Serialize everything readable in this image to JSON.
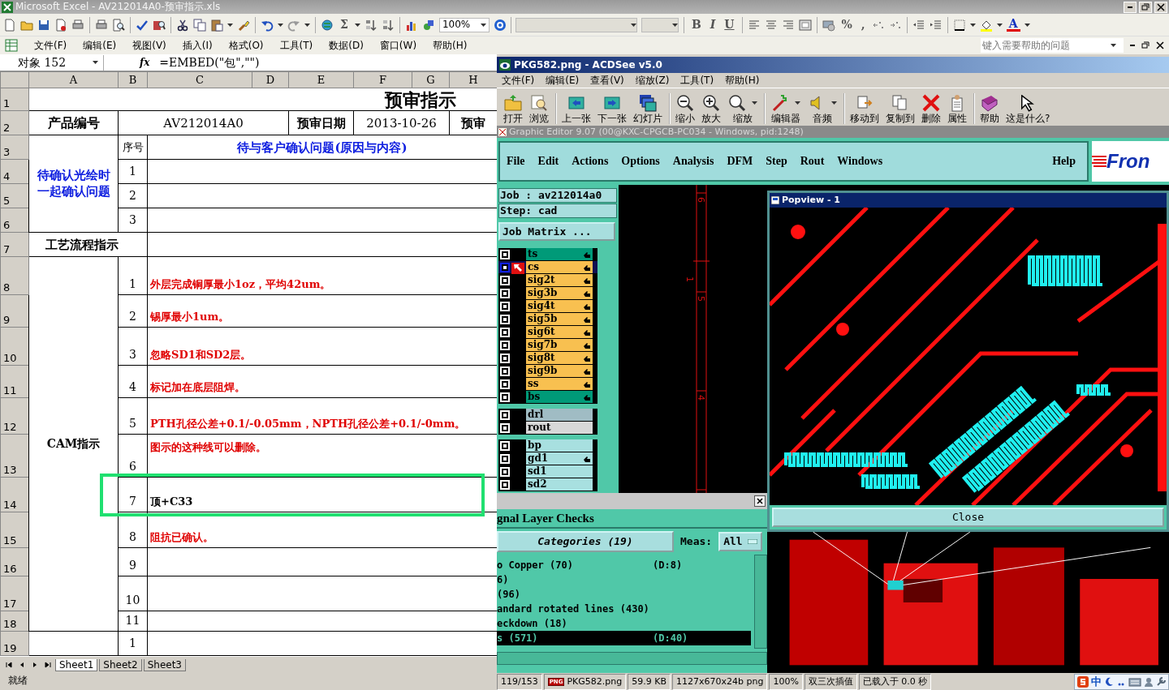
{
  "excel": {
    "title": "Microsoft Excel - AV212014A0-预审指示.xls",
    "sum_glyph": "Σ",
    "zoom": "100%",
    "format_glyphs": [
      "B",
      "I",
      "U"
    ],
    "number_glyphs": [
      "%",
      ","
    ],
    "font_color_glyph": "A",
    "menu": [
      "文件(F)",
      "编辑(E)",
      "视图(V)",
      "插入(I)",
      "格式(O)",
      "工具(T)",
      "数据(D)",
      "窗口(W)",
      "帮助(H)"
    ],
    "help_placeholder": "键入需要帮助的问题",
    "name_box": "对象 152",
    "function_glyph": "fx",
    "formula": "=EMBED(\"包\",\"\")",
    "columns": [
      "A",
      "B",
      "C",
      "D",
      "E",
      "F",
      "G",
      "H"
    ],
    "row_numbers": [
      "1",
      "2",
      "3",
      "4",
      "5",
      "6",
      "7",
      "8",
      "9",
      "10",
      "11",
      "12",
      "13",
      "14",
      "15",
      "16",
      "17",
      "18",
      "19"
    ],
    "sheet": {
      "title": "预审指示",
      "product_label": "产品编号",
      "product_no": "AV212014A0",
      "date_label": "预审日期",
      "date": "2013-10-26",
      "review_label": "预审",
      "confirm_label": "待确认光绘时一起确认问题",
      "seq_label": "序号",
      "question_label": "待与客户确认问题(原因与内容)",
      "confirm_numbers": [
        "1",
        "2",
        "3"
      ],
      "process_label": "工艺流程指示",
      "cam_label": "CAM指示",
      "cam_items": [
        {
          "no": "1",
          "text": "外层完成铜厚最小1oz，平均42um。",
          "color": "#e00000"
        },
        {
          "no": "2",
          "text": "锡厚最小1um。",
          "color": "#e00000"
        },
        {
          "no": "3",
          "text": "忽略SD1和SD2层。",
          "color": "#e00000"
        },
        {
          "no": "4",
          "text": "标记加在底层阻焊。",
          "color": "#e00000"
        },
        {
          "no": "5",
          "text": "PTH孔径公差+0.1/-0.05mm，NPTH孔径公差+0.1/-0mm。",
          "color": "#e00000"
        },
        {
          "no": "6",
          "text": "图示的这种线可以删除。",
          "color": "#e00000"
        },
        {
          "no": "7",
          "text": "顶+C33",
          "color": "#000000"
        },
        {
          "no": "8",
          "text": "阻抗已确认。",
          "color": "#e00000"
        },
        {
          "no": "9"
        },
        {
          "no": "10"
        },
        {
          "no": "11"
        }
      ],
      "last_row_no": "1"
    },
    "sheet_tabs": [
      {
        "label": "Sheet1",
        "selected": true
      },
      {
        "label": "Sheet2",
        "selected": false
      },
      {
        "label": "Sheet3",
        "selected": false
      }
    ],
    "status": "就绪"
  },
  "acdsee": {
    "title": "PKG582.png - ACDSee v5.0",
    "menu": [
      "文件(F)",
      "编辑(E)",
      "查看(V)",
      "缩放(Z)",
      "工具(T)",
      "帮助(H)"
    ],
    "toolbar": [
      {
        "label": "打开",
        "dropdown": false,
        "separator_after": false
      },
      {
        "label": "浏览",
        "dropdown": false,
        "separator_after": true
      },
      {
        "label": "上一张",
        "dropdown": false,
        "separator_after": false
      },
      {
        "label": "下一张",
        "dropdown": false,
        "separator_after": false
      },
      {
        "label": "幻灯片",
        "dropdown": false,
        "separator_after": true
      },
      {
        "label": "缩小",
        "dropdown": false,
        "separator_after": false
      },
      {
        "label": "放大",
        "dropdown": false,
        "separator_after": false
      },
      {
        "label": "缩放",
        "dropdown": true,
        "separator_after": true
      },
      {
        "label": "编辑器",
        "dropdown": true,
        "separator_after": false
      },
      {
        "label": "音频",
        "dropdown": true,
        "separator_after": true
      },
      {
        "label": "移动到",
        "dropdown": false,
        "separator_after": false
      },
      {
        "label": "复制到",
        "dropdown": false,
        "separator_after": false
      },
      {
        "label": "删除",
        "dropdown": false,
        "separator_after": false
      },
      {
        "label": "属性",
        "dropdown": false,
        "separator_after": true
      },
      {
        "label": "帮助",
        "dropdown": false,
        "separator_after": false
      },
      {
        "label": "这是什么?",
        "dropdown": false,
        "separator_after": false
      }
    ],
    "image": {
      "title": "Graphic Editor 9.07 (00@KXC-CPGCB-PC034 - Windows, pid:1248)",
      "menu": [
        "File",
        "Edit",
        "Actions",
        "Options",
        "Analysis",
        "DFM",
        "Step",
        "Rout",
        "Windows"
      ],
      "help": "Help",
      "logo": "Fron",
      "job": "Job : av212014a0",
      "step": "Step: cad",
      "job_matrix": "Job Matrix ...",
      "layer_groups": [
        {
          "layers": [
            {
              "name": "ts",
              "color": "#009a78",
              "affected": true,
              "checked": true,
              "selected": false
            },
            {
              "name": "cs",
              "color": "#f8c050",
              "affected": true,
              "checked": true,
              "selected": true
            },
            {
              "name": "sig2t",
              "color": "#f8c050",
              "affected": true,
              "checked": true,
              "selected": false
            },
            {
              "name": "sig3b",
              "color": "#f8c050",
              "affected": true,
              "checked": true,
              "selected": false
            },
            {
              "name": "sig4t",
              "color": "#f8c050",
              "affected": true,
              "checked": true,
              "selected": false
            },
            {
              "name": "sig5b",
              "color": "#f8c050",
              "affected": true,
              "checked": true,
              "selected": false
            },
            {
              "name": "sig6t",
              "color": "#f8c050",
              "affected": true,
              "checked": true,
              "selected": false
            },
            {
              "name": "sig7b",
              "color": "#f8c050",
              "affected": true,
              "checked": true,
              "selected": false
            },
            {
              "name": "sig8t",
              "color": "#f8c050",
              "affected": true,
              "checked": true,
              "selected": false
            },
            {
              "name": "sig9b",
              "color": "#f8c050",
              "affected": true,
              "checked": true,
              "selected": false
            },
            {
              "name": "ss",
              "color": "#f8c050",
              "affected": true,
              "checked": true,
              "selected": false
            },
            {
              "name": "bs",
              "color": "#009a78",
              "affected": true,
              "checked": true,
              "selected": false
            }
          ]
        },
        {
          "layers": [
            {
              "name": "drl",
              "color": "#a0bcc4",
              "affected": false,
              "checked": true,
              "selected": false
            },
            {
              "name": "rout",
              "color": "#d8d8d8",
              "affected": false,
              "checked": true,
              "selected": false
            }
          ]
        },
        {
          "layers": [
            {
              "name": "bp",
              "color": "#a8e0e0",
              "affected": false,
              "checked": true,
              "selected": false
            },
            {
              "name": "gd1",
              "color": "#a8e0e0",
              "affected": true,
              "checked": true,
              "selected": false
            },
            {
              "name": "sd1",
              "color": "#a8e0e0",
              "affected": false,
              "checked": true,
              "selected": false
            },
            {
              "name": "sd2",
              "color": "#a8e0e0",
              "affected": false,
              "checked": true,
              "selected": false
            }
          ]
        }
      ],
      "ruler_labels": [
        "6",
        "5",
        "4"
      ],
      "cursor_label": "1",
      "popview": {
        "title": "Popview - 1",
        "close": "Close"
      },
      "checks": {
        "title": "gnal Layer Checks",
        "categories": "Categories (19)",
        "meas_label": "Meas:",
        "meas_value": "All",
        "lines": [
          {
            "text": "o Copper (70)",
            "d": "(D:8)",
            "selected": false
          },
          {
            "text": "6)",
            "selected": false
          },
          {
            "text": "(96)",
            "selected": false
          },
          {
            "text": "andard rotated lines (430)",
            "selected": false
          },
          {
            "text": "eckdown (18)",
            "selected": false
          },
          {
            "text": "s (571)",
            "d": "(D:40)",
            "selected": true
          }
        ]
      }
    },
    "status_cells": [
      {
        "text": "119/153"
      },
      {
        "text": "PKG582.png",
        "badge": "PNG"
      },
      {
        "text": "59.9 KB"
      },
      {
        "text": "1127x670x24b png"
      },
      {
        "text": "100%"
      },
      {
        "text": "双三次插值"
      },
      {
        "text": "已载入于 0.0 秒"
      }
    ],
    "ime_label": "中"
  }
}
